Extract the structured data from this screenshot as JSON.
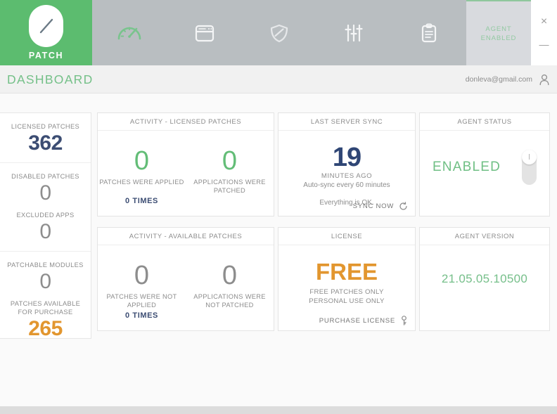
{
  "brand": {
    "name": "PATCH",
    "accent": "#5cbc6f"
  },
  "nav": {
    "items": [
      {
        "name": "dashboard",
        "icon": "gauge-icon",
        "active": true
      },
      {
        "name": "applications",
        "icon": "window-icon",
        "active": false
      },
      {
        "name": "security",
        "icon": "shield-icon",
        "active": false
      },
      {
        "name": "settings",
        "icon": "sliders-icon",
        "active": false
      },
      {
        "name": "reports",
        "icon": "clipboard-icon",
        "active": false
      }
    ],
    "agent_badge": "AGENT\nENABLED",
    "agent_badge_line1": "AGENT",
    "agent_badge_line2": "ENABLED",
    "close_label": "×",
    "minimize_label": "—"
  },
  "header": {
    "title": "DASHBOARD",
    "user_email": "donleva@gmail.com"
  },
  "sidebar_stats": [
    {
      "rows": [
        {
          "label": "LICENSED PATCHES",
          "value": "362",
          "color": "blue"
        }
      ]
    },
    {
      "rows": [
        {
          "label": "DISABLED PATCHES",
          "value": "0",
          "color": "gray"
        },
        {
          "label": "EXCLUDED APPS",
          "value": "0",
          "color": "gray"
        }
      ]
    },
    {
      "rows": [
        {
          "label": "PATCHABLE MODULES",
          "value": "0",
          "color": "gray"
        },
        {
          "label": "PATCHES AVAILABLE FOR PURCHASE",
          "value": "265",
          "color": "orange"
        }
      ]
    }
  ],
  "cards": {
    "activity_licensed": {
      "title": "ACTIVITY - LICENSED PATCHES",
      "left_value": "0",
      "left_label": "PATCHES WERE APPLIED",
      "right_value": "0",
      "right_label": "APPLICATIONS WERE PATCHED",
      "times": "0  TIMES"
    },
    "last_sync": {
      "title": "LAST SERVER SYNC",
      "value": "19",
      "unit": "MINUTES AGO",
      "subtitle": "Auto-sync every 60 minutes",
      "status": "Everything is OK.",
      "action": "SYNC NOW"
    },
    "agent_status": {
      "title": "AGENT STATUS",
      "status": "ENABLED"
    },
    "activity_available": {
      "title": "ACTIVITY - AVAILABLE PATCHES",
      "left_value": "0",
      "left_label": "PATCHES WERE NOT APPLIED",
      "right_value": "0",
      "right_label": "APPLICATIONS WERE NOT PATCHED",
      "times": "0  TIMES"
    },
    "license": {
      "title": "LICENSE",
      "value": "FREE",
      "line1": "FREE PATCHES ONLY",
      "line2": "PERSONAL USE ONLY",
      "action": "PURCHASE LICENSE"
    },
    "agent_version": {
      "title": "AGENT VERSION",
      "value": "21.05.05.10500"
    }
  }
}
